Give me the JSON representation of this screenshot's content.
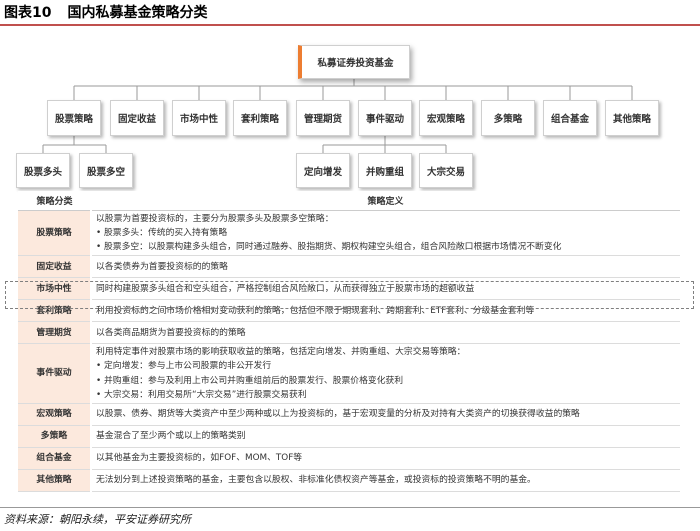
{
  "figure": {
    "number": "图表10",
    "title": "国内私募基金策略分类"
  },
  "tree": {
    "root": "私募证券投资基金",
    "level1": [
      "股票策略",
      "固定收益",
      "市场中性",
      "套利策略",
      "管理期货",
      "事件驱动",
      "宏观策略",
      "多策略",
      "组合基金",
      "其他策略"
    ],
    "stock_children": [
      "股票多头",
      "股票多空"
    ],
    "event_children": [
      "定向增发",
      "并购重组",
      "大宗交易"
    ]
  },
  "table": {
    "header": {
      "category": "策略分类",
      "definition": "策略定义"
    },
    "rows": [
      {
        "category": "股票策略",
        "lines": [
          "以股票为首要投资标的，主要分为股票多头及股票多空策略：",
          "• 股票多头：传统的买入持有策略",
          "• 股票多空：以股票构建多头组合，同时通过融券、股指期货、期权构建空头组合，组合风险敞口根据市场情况不断变化"
        ]
      },
      {
        "category": "固定收益",
        "lines": [
          "以各类债券为首要投资标的的策略"
        ]
      },
      {
        "category": "市场中性",
        "lines": [
          "同时构建股票多头组合和空头组合，严格控制组合风险敞口，从而获得独立于股票市场的超额收益"
        ]
      },
      {
        "category": "套利策略",
        "lines": [
          "利用投资标的之间市场价格相对变动获利的策略，包括但不限于期现套利、跨期套利、ETF套利、分级基金套利等"
        ]
      },
      {
        "category": "管理期货",
        "lines": [
          "以各类商品期货为首要投资标的的策略"
        ]
      },
      {
        "category": "事件驱动",
        "lines": [
          "利用特定事件对股票市场的影响获取收益的策略，包括定向增发、并购重组、大宗交易等策略：",
          "• 定向增发：参与上市公司股票的非公开发行",
          "• 并购重组：参与及利用上市公司并购重组前后的股票发行、股票价格变化获利",
          "• 大宗交易：利用交易所“大宗交易”进行股票交易获利"
        ]
      },
      {
        "category": "宏观策略",
        "lines": [
          "以股票、债券、期货等大类资产中至少两种或以上为投资标的，基于宏观变量的分析及对持有大类资产的切换获得收益的策略"
        ]
      },
      {
        "category": "多策略",
        "lines": [
          "基金混合了至少两个或以上的策略类别"
        ]
      },
      {
        "category": "组合基金",
        "lines": [
          "以其他基金为主要投资标的，如FOF、MOM、TOF等"
        ]
      },
      {
        "category": "其他策略",
        "lines": [
          "无法划分到上述投资策略的基金，主要包含以股权、非标准化债权资产等基金，或投资标的投资策略不明的基金。"
        ]
      }
    ]
  },
  "source": "资料来源：朝阳永续，平安证券研究所",
  "colors": {
    "accent_red": "#c0504d",
    "root_accent_orange": "#ed7d31",
    "category_fill": "#fce9dd"
  }
}
